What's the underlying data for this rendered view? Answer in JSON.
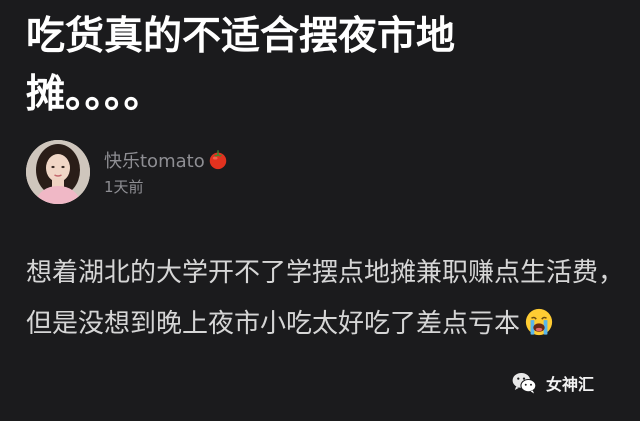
{
  "post": {
    "title": "吃货真的不适合摆夜市地摊。。。。",
    "author": {
      "name": "快乐tomato",
      "badge_icon": "tomato-icon",
      "time": "1天前"
    },
    "content": "想着湖北的大学开不了学摆点地摊兼职赚点生活费，但是没想到晚上夜市小吃太好吃了差点亏本",
    "content_emoji_icon": "loudly-crying-face-icon"
  },
  "watermark": {
    "icon": "wechat-icon",
    "label": "女神汇"
  },
  "colors": {
    "background": "#1b1b1d",
    "title": "#ffffff",
    "meta": "#8e8e93",
    "body_text": "#d6d6d6"
  }
}
